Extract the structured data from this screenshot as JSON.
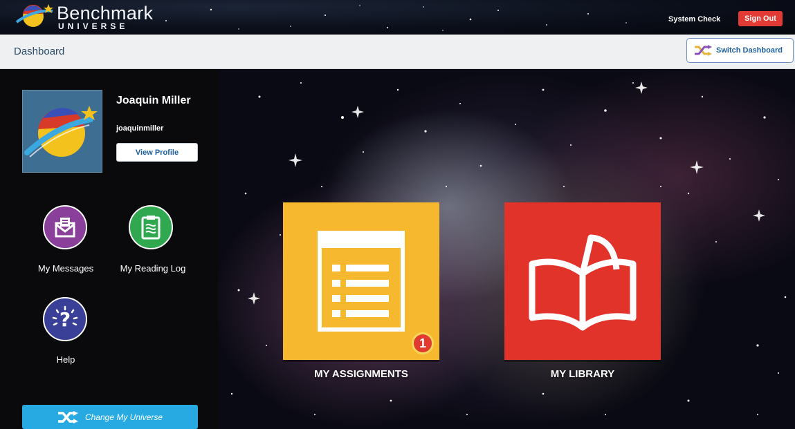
{
  "header": {
    "logo_main": "Benchmark",
    "logo_sub": "UNIVERSE",
    "system_check_label": "System Check",
    "sign_out_label": "Sign Out"
  },
  "dashboard_bar": {
    "title": "Dashboard",
    "switch_label": "Switch Dashboard"
  },
  "sidebar": {
    "user": {
      "name": "Joaquin Miller",
      "username": "joaquinmiller",
      "view_profile_label": "View Profile"
    },
    "shortcuts": [
      {
        "label": "My Messages",
        "icon": "envelope-icon",
        "color": "#8a3f9a"
      },
      {
        "label": "My Reading Log",
        "icon": "clipboard-icon",
        "color": "#2fa84f"
      },
      {
        "label": "Help",
        "icon": "help-icon",
        "color": "#3a3f98"
      }
    ],
    "change_universe_label": "Change My Universe"
  },
  "tiles": [
    {
      "label": "MY ASSIGNMENTS",
      "icon": "assignment-list-icon",
      "color": "#f5b82e",
      "badge": "1"
    },
    {
      "label": "MY LIBRARY",
      "icon": "open-book-icon",
      "color": "#e2332b"
    }
  ],
  "colors": {
    "sign_out": "#e23b35",
    "change_universe": "#27a9e1",
    "link_blue": "#1d5f9f"
  }
}
